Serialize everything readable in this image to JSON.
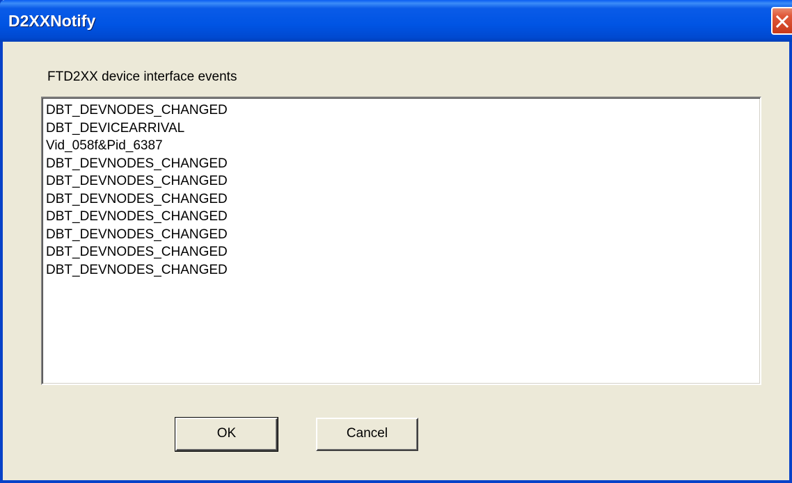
{
  "window": {
    "title": "D2XXNotify"
  },
  "dialog": {
    "label": "FTD2XX device interface events",
    "events": [
      "DBT_DEVNODES_CHANGED",
      "DBT_DEVICEARRIVAL",
      "Vid_058f&Pid_6387",
      "DBT_DEVNODES_CHANGED",
      "DBT_DEVNODES_CHANGED",
      "DBT_DEVNODES_CHANGED",
      "DBT_DEVNODES_CHANGED",
      "DBT_DEVNODES_CHANGED",
      "DBT_DEVNODES_CHANGED",
      "DBT_DEVNODES_CHANGED"
    ]
  },
  "buttons": {
    "ok_label": "OK",
    "cancel_label": "Cancel"
  },
  "icons": {
    "close": "close-icon"
  },
  "colors": {
    "titlebar": "#0054e3",
    "dialog_bg": "#ece9d8",
    "close_button": "#e0593a"
  }
}
